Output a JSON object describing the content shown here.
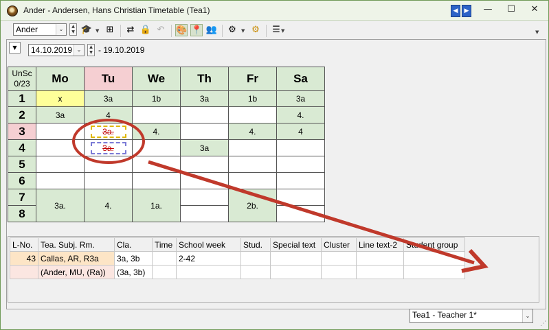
{
  "window": {
    "title": "Ander - Andersen, Hans Christian  Timetable  (Tea1)",
    "prev_icon": "◀",
    "next_icon": "▶",
    "minimize": "—",
    "maximize": "☐",
    "close": "✕"
  },
  "toolbar": {
    "element_select": "Ander",
    "dropdown_arrow": "⌄",
    "spin_up": "▲",
    "spin_down": "▼"
  },
  "date": {
    "start": "14.10.2019",
    "end_text": "- 19.10.2019"
  },
  "timetable": {
    "corner_line1": "UnSc",
    "corner_line2": "0/23",
    "days": [
      "Mo",
      "Tu",
      "We",
      "Th",
      "Fr",
      "Sa"
    ],
    "periods": [
      "1",
      "2",
      "3",
      "4",
      "5",
      "6",
      "7",
      "8"
    ],
    "cells": {
      "p1": [
        "x",
        "3a",
        "1b",
        "3a",
        "1b",
        "3a"
      ],
      "p2_mo": "3a",
      "p2_tu": "4",
      "p2_sa": "4.",
      "p3_tu": "3a.",
      "p3_we": "4.",
      "p3_fr": "4.",
      "p3_sa": "4",
      "p4_tu": "3a.",
      "p4_th": "3a",
      "p78_mo": "3a.",
      "p78_tu": "4.",
      "p78_we": "1a.",
      "p78_fr": "2b."
    }
  },
  "lessons": {
    "headers": [
      "L-No.",
      "Tea. Subj. Rm.",
      "Cla.",
      "Time",
      "School week",
      "Stud.",
      "Special text",
      "Cluster",
      "Line text-2",
      "Student group"
    ],
    "rows": [
      [
        "43",
        "Callas, AR, R3a",
        "3a, 3b",
        "",
        "2-42",
        "",
        "",
        "",
        "",
        ""
      ],
      [
        "",
        "(Ander, MU, (Ra))",
        "(3a, 3b)",
        "",
        "",
        "",
        "",
        "",
        "",
        ""
      ]
    ]
  },
  "footer": {
    "teacher_select": "Tea1 - Teacher 1*"
  },
  "annotation": {
    "color": "#c0392b"
  }
}
